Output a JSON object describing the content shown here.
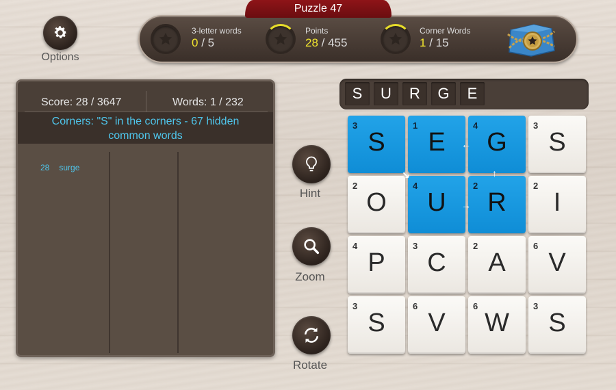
{
  "puzzle_title": "Puzzle 47",
  "options": {
    "label": "Options",
    "icon": "gear-icon"
  },
  "stats": [
    {
      "label": "3-letter words",
      "current": "0",
      "total": "/ 5",
      "progress": 0.0
    },
    {
      "label": "Points",
      "current": "28",
      "total": "/ 455",
      "progress": 0.06
    },
    {
      "label": "Corner Words",
      "current": "1",
      "total": "/ 15",
      "progress": 0.07
    }
  ],
  "panel": {
    "score": "Score: 28 / 3647",
    "words": "Words: 1 / 232",
    "corners_line1": "Corners: \"S\" in the corners - 67 hidden",
    "corners_line2": "common words",
    "found": [
      {
        "points": "28",
        "word": "surge"
      }
    ]
  },
  "buttons": {
    "hint": "Hint",
    "zoom": "Zoom",
    "rotate": "Rotate"
  },
  "current_word": [
    "S",
    "U",
    "R",
    "G",
    "E"
  ],
  "grid": [
    [
      {
        "p": "3",
        "l": "S",
        "sel": true
      },
      {
        "p": "1",
        "l": "E",
        "sel": true
      },
      {
        "p": "4",
        "l": "G",
        "sel": true
      },
      {
        "p": "3",
        "l": "S",
        "sel": false
      }
    ],
    [
      {
        "p": "2",
        "l": "O",
        "sel": false
      },
      {
        "p": "4",
        "l": "U",
        "sel": true
      },
      {
        "p": "2",
        "l": "R",
        "sel": true
      },
      {
        "p": "2",
        "l": "I",
        "sel": false
      }
    ],
    [
      {
        "p": "4",
        "l": "P",
        "sel": false
      },
      {
        "p": "3",
        "l": "C",
        "sel": false
      },
      {
        "p": "2",
        "l": "A",
        "sel": false
      },
      {
        "p": "6",
        "l": "V",
        "sel": false
      }
    ],
    [
      {
        "p": "3",
        "l": "S",
        "sel": false
      },
      {
        "p": "6",
        "l": "V",
        "sel": false
      },
      {
        "p": "6",
        "l": "W",
        "sel": false
      },
      {
        "p": "3",
        "l": "S",
        "sel": false
      }
    ]
  ],
  "colors": {
    "accent": "#1a9be0",
    "highlight": "#f2e62e",
    "info": "#4fc6ec",
    "puzzle_tab": "#8e1418"
  }
}
